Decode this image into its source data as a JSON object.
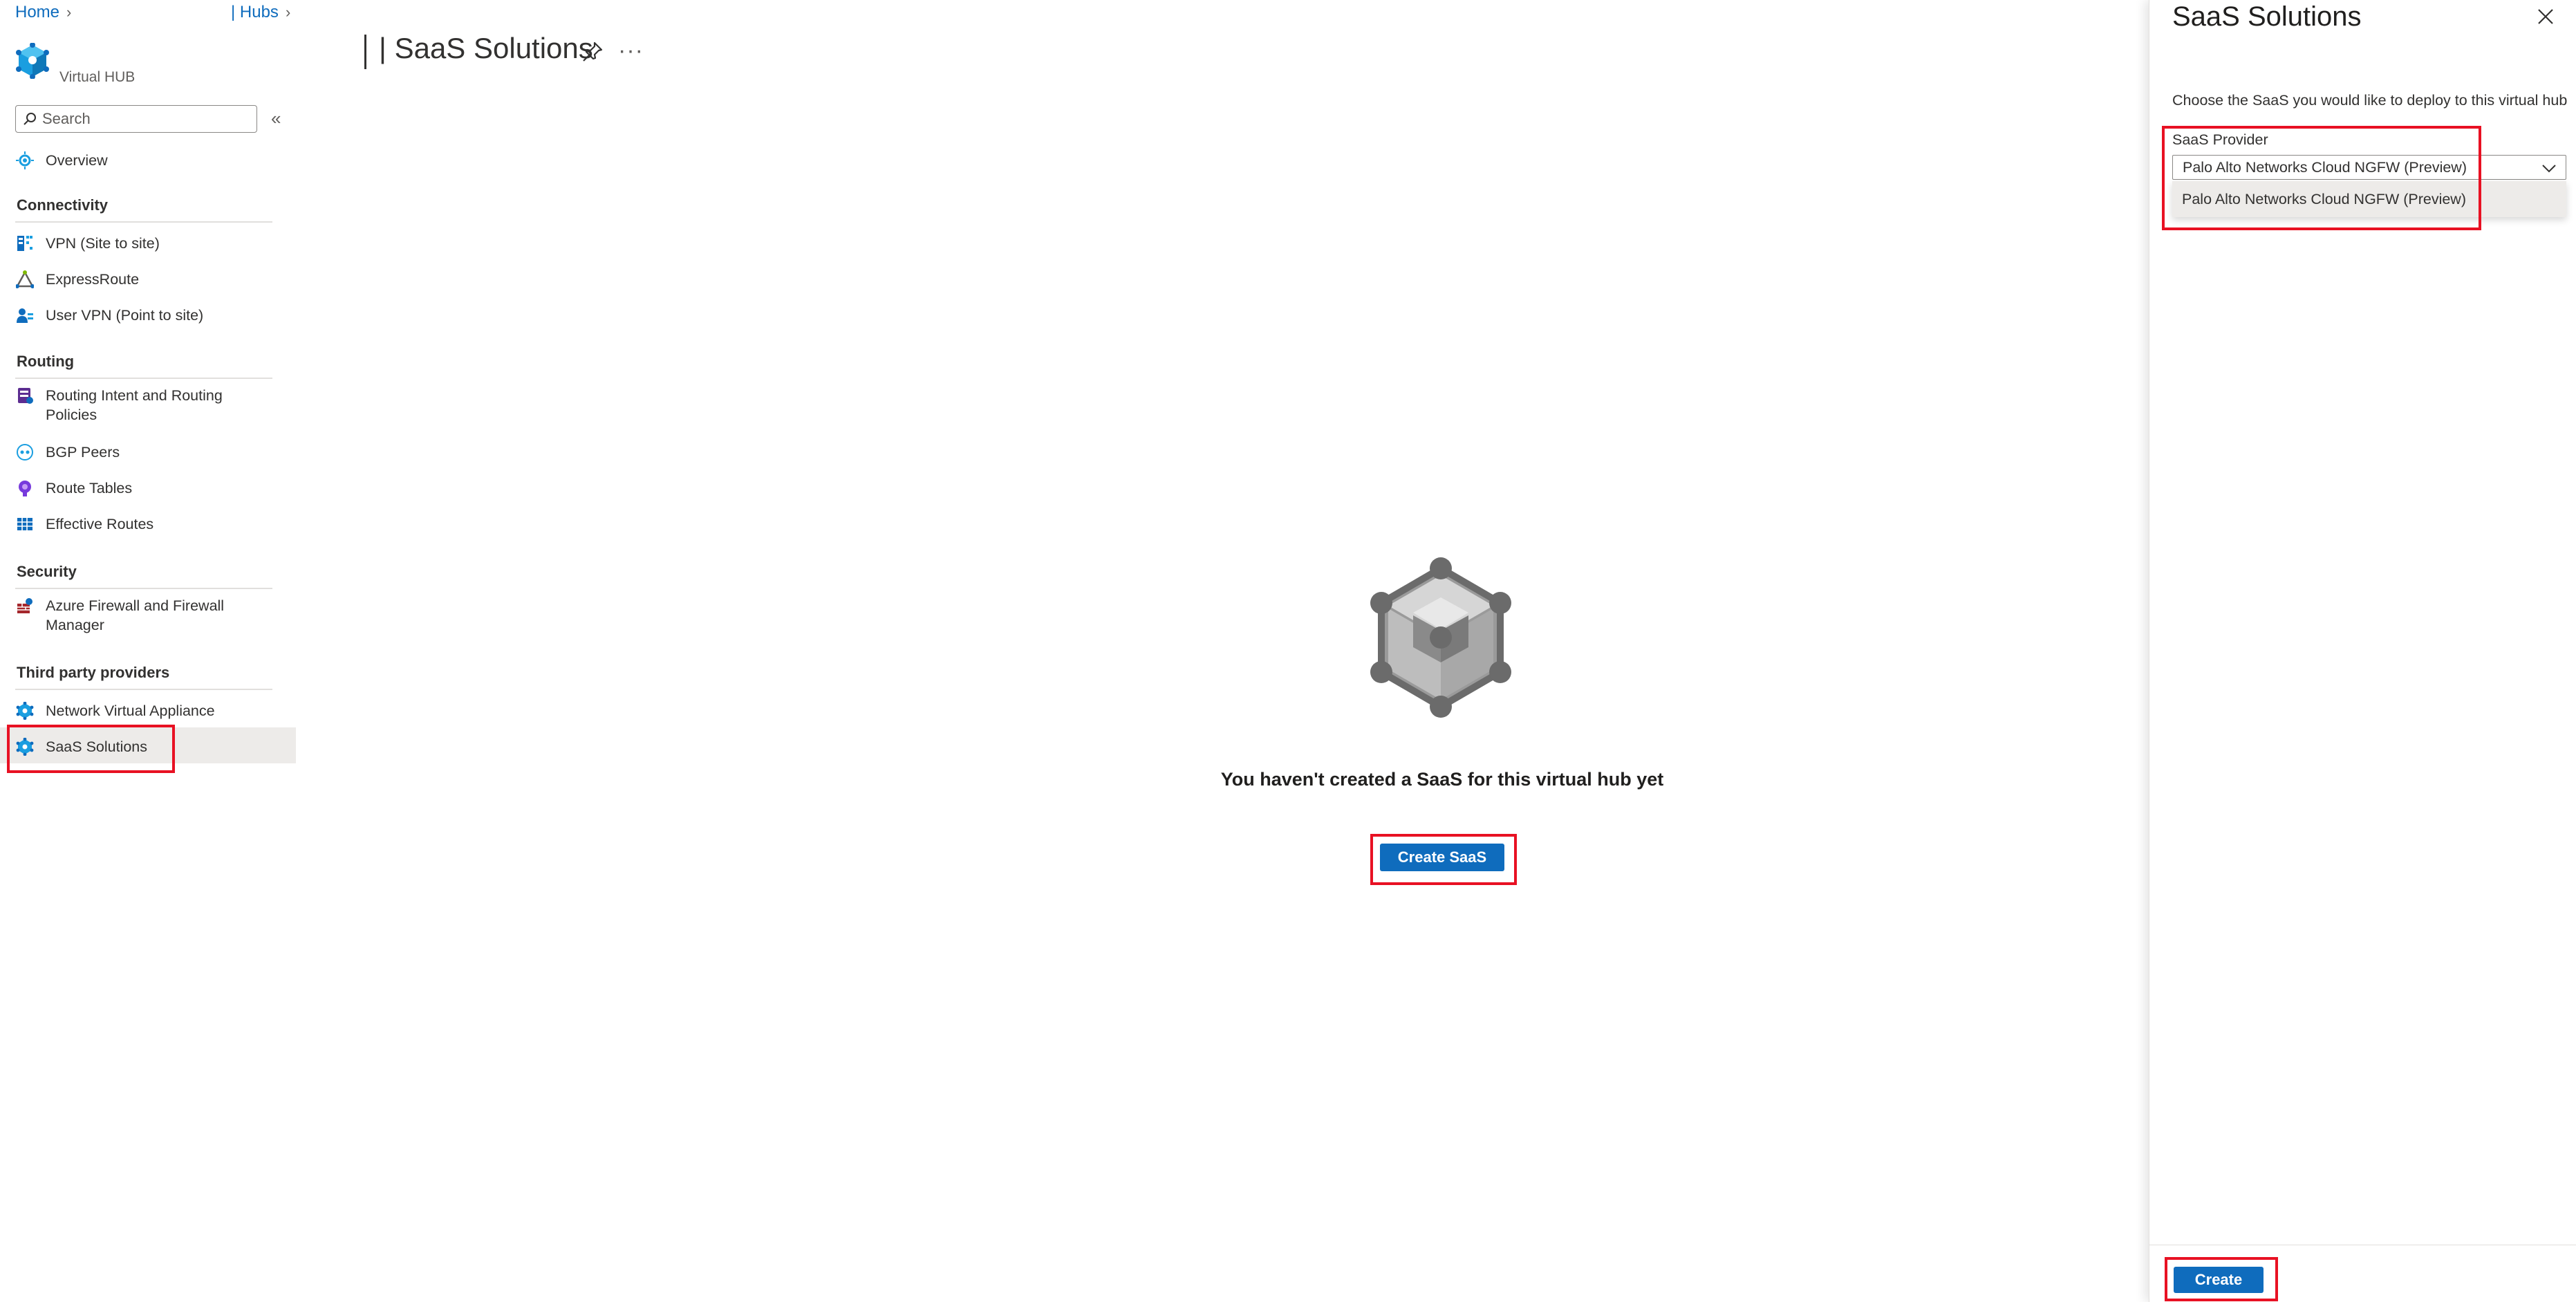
{
  "breadcrumb": {
    "home": "Home",
    "hubs": "| Hubs"
  },
  "hub": {
    "subtitle": "Virtual HUB"
  },
  "search": {
    "placeholder": "Search"
  },
  "nav": {
    "overview": "Overview",
    "sections": {
      "connectivity": "Connectivity",
      "routing": "Routing",
      "security": "Security",
      "third_party": "Third party providers"
    },
    "items": {
      "vpn": "VPN (Site to site)",
      "expressroute": "ExpressRoute",
      "user_vpn": "User VPN (Point to site)",
      "routing_intent_1": "Routing Intent and Routing",
      "routing_intent_2": "Policies",
      "bgp_peers": "BGP Peers",
      "route_tables": "Route Tables",
      "effective_routes": "Effective Routes",
      "azure_firewall_1": "Azure Firewall and Firewall",
      "azure_firewall_2": "Manager",
      "nva": "Network Virtual Appliance",
      "saas": "SaaS Solutions"
    }
  },
  "main": {
    "title": "| SaaS Solutions",
    "more": "···",
    "empty_message": "You haven't created a SaaS for this virtual hub yet",
    "create_saas_label": "Create SaaS"
  },
  "panel": {
    "title": "SaaS Solutions",
    "description": "Choose the SaaS you would like to deploy to this virtual hub",
    "provider_label": "SaaS Provider",
    "provider_selected": "Palo Alto Networks Cloud NGFW (Preview)",
    "provider_options": [
      "Palo Alto Networks Cloud NGFW (Preview)"
    ],
    "create_label": "Create"
  },
  "colors": {
    "accent": "#0f6cbd",
    "highlight_box": "#e81123",
    "selected_bg": "#edebe9"
  }
}
